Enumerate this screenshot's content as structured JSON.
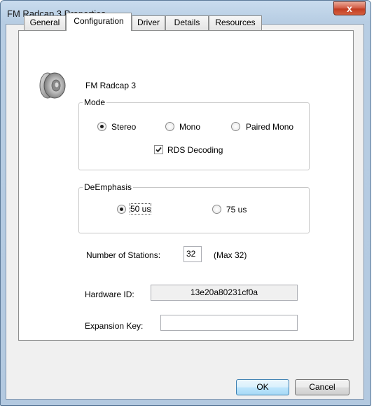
{
  "window": {
    "title": "FM Radcap 3 Properties",
    "close_glyph": "x"
  },
  "tabs": [
    {
      "label": "General",
      "active": false
    },
    {
      "label": "Configuration",
      "active": true
    },
    {
      "label": "Driver",
      "active": false
    },
    {
      "label": "Details",
      "active": false
    },
    {
      "label": "Resources",
      "active": false
    }
  ],
  "device": {
    "icon": "speaker-icon",
    "name": "FM Radcap 3"
  },
  "mode": {
    "title": "Mode",
    "options": [
      {
        "label": "Stereo",
        "checked": true
      },
      {
        "label": "Mono",
        "checked": false
      },
      {
        "label": "Paired Mono",
        "checked": false
      }
    ],
    "rds": {
      "label": "RDS Decoding",
      "checked": true
    }
  },
  "deemphasis": {
    "title": "DeEmphasis",
    "options": [
      {
        "label": "50 us",
        "checked": true
      },
      {
        "label": "75 us",
        "checked": false
      }
    ]
  },
  "stations": {
    "label": "Number of Stations:",
    "value": "32",
    "max_note": "(Max 32)"
  },
  "hardware": {
    "label": "Hardware ID:",
    "value": "13e20a80231cf0a"
  },
  "expansion": {
    "label": "Expansion Key:",
    "value": ""
  },
  "buttons": {
    "ok": "OK",
    "cancel": "Cancel"
  }
}
